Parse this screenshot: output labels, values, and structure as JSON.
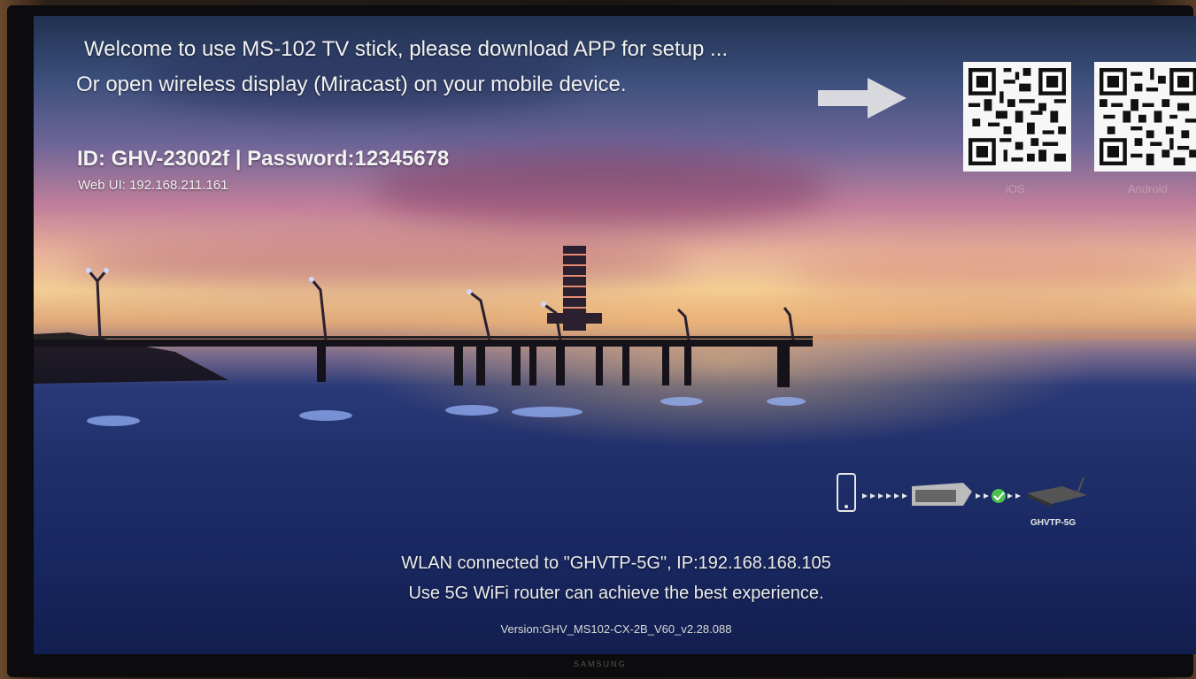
{
  "welcome": {
    "line1": "Welcome to use MS-102 TV stick, please download APP for setup ...",
    "line2": "Or open wireless display (Miracast) on your mobile device."
  },
  "device": {
    "credentials": "ID: GHV-23002f | Password:12345678",
    "web_ui": "Web UI: 192.168.211.161"
  },
  "qr_codes": [
    {
      "label": "iOS"
    },
    {
      "label": "Android"
    }
  ],
  "network": {
    "status": "WLAN connected to \"GHVTP-5G\", IP:192.168.168.105",
    "tip": "Use 5G WiFi router can achieve the best experience.",
    "router_ssid": "GHVTP-5G"
  },
  "version": "Version:GHV_MS102-CX-2B_V60_v2.28.088",
  "tv_brand": "SAMSUNG",
  "colors": {
    "sky_top": "#20314f",
    "sunset": "#f3cd95",
    "water": "#1f2f6a",
    "check": "#4cc04c"
  },
  "icons": [
    "arrow-right-icon",
    "phone-icon",
    "tv-stick-icon",
    "check-icon",
    "router-icon"
  ]
}
